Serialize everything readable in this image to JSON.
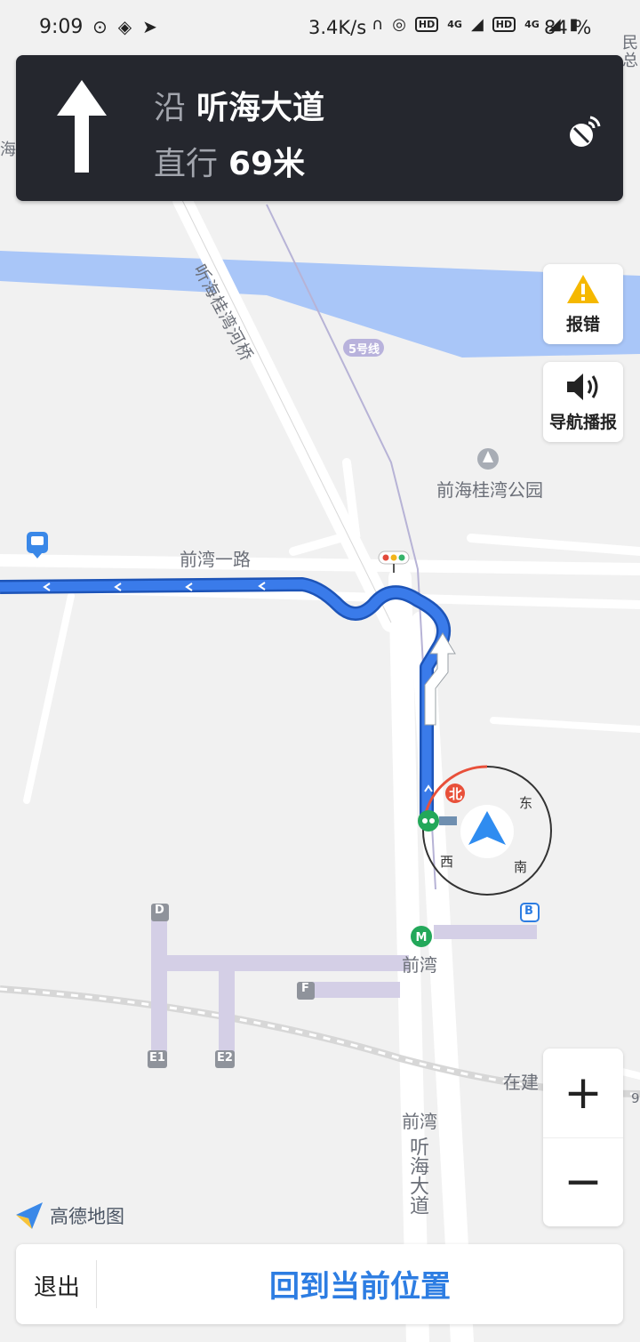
{
  "status_bar": {
    "time": "9:09",
    "net_speed": "3.4K/s",
    "badges": [
      "HD",
      "4G",
      "HD",
      "4G"
    ],
    "battery": "84 %"
  },
  "nav": {
    "along_prefix": "沿",
    "road_name": "听海大道",
    "action": "直行",
    "distance": "69米"
  },
  "map_labels": {
    "bridge": "听海桂湾河桥",
    "metro_line": "5号线",
    "park": "前海桂湾公园",
    "road_top": "前湾一路",
    "station_1": "前湾",
    "station_2": "前湾",
    "road_main": "听海大道",
    "under_construction": "在建",
    "exit_D": "D",
    "exit_B": "B",
    "exit_F": "F",
    "exit_E1": "E1",
    "exit_E2": "E2",
    "edge_1": "民",
    "edge_2": "总",
    "edge_3": "海大",
    "edge_4": "9"
  },
  "compass": {
    "north": "北",
    "east": "东",
    "south": "南",
    "west": "西"
  },
  "side_buttons": {
    "report": "报错",
    "voice": "导航播报"
  },
  "zoom": {
    "in": "+",
    "out": "−"
  },
  "logo_text": "高德地图",
  "bottom": {
    "exit": "退出",
    "recenter": "回到当前位置"
  },
  "colors": {
    "route": "#3a7bea",
    "nav_card": "#25272e",
    "accent_blue": "#2d7de2",
    "warning": "#f5b800",
    "water": "#a9c6f8"
  }
}
